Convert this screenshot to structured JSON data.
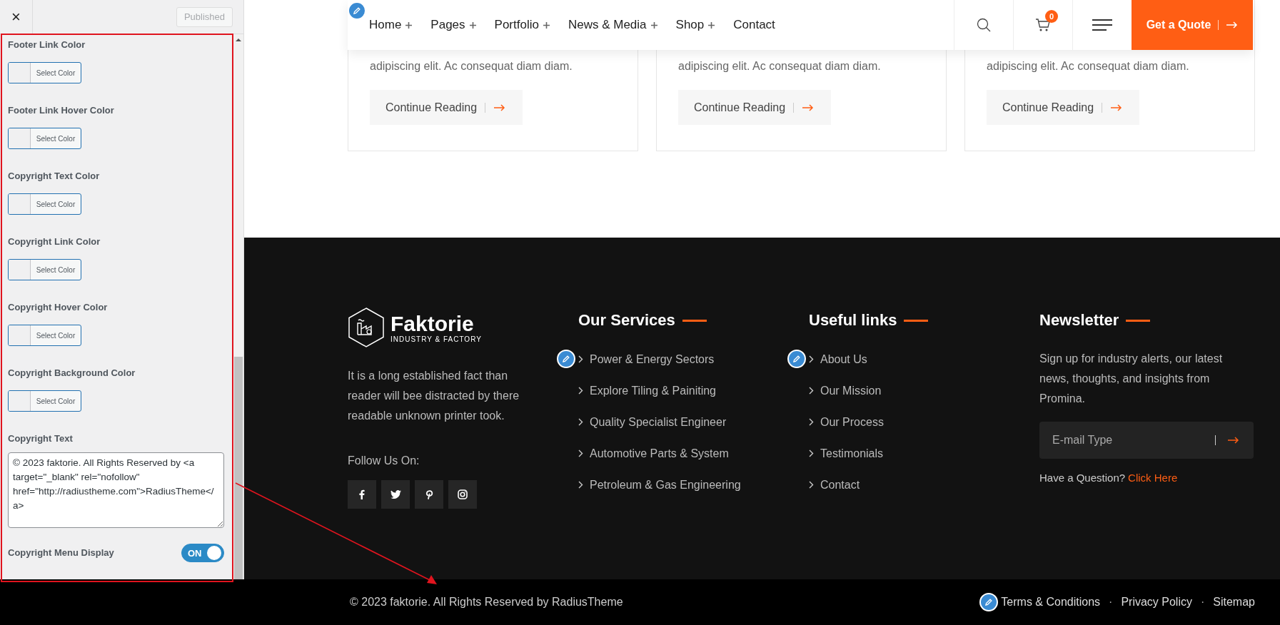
{
  "customizer": {
    "close": "×",
    "publish_button": "Published",
    "color_settings": [
      {
        "label": "Footer Link Color",
        "button": "Select Color"
      },
      {
        "label": "Footer Link Hover Color",
        "button": "Select Color"
      },
      {
        "label": "Copyright Text Color",
        "button": "Select Color"
      },
      {
        "label": "Copyright Link Color",
        "button": "Select Color"
      },
      {
        "label": "Copyright Hover Color",
        "button": "Select Color"
      },
      {
        "label": "Copyright Background Color",
        "button": "Select Color"
      }
    ],
    "copyright_text": {
      "label": "Copyright Text",
      "value": "© 2023 faktorie. All Rights Reserved by <a target=\"_blank\" rel=\"nofollow\" href=\"http://radiustheme.com\">RadiusTheme</a>"
    },
    "copyright_menu": {
      "label": "Copyright Menu Display",
      "toggle_text": "ON",
      "on": true
    }
  },
  "nav": {
    "items": [
      {
        "label": "Home",
        "has_submenu": true
      },
      {
        "label": "Pages",
        "has_submenu": true
      },
      {
        "label": "Portfolio",
        "has_submenu": true
      },
      {
        "label": "News & Media",
        "has_submenu": true
      },
      {
        "label": "Shop",
        "has_submenu": true
      },
      {
        "label": "Contact",
        "has_submenu": false
      }
    ],
    "cart_count": "0",
    "quote_button": "Get a Quote"
  },
  "posts": [
    {
      "excerpt": "adipiscing elit. Ac consequat diam diam.",
      "button": "Continue Reading"
    },
    {
      "excerpt": "adipiscing elit. Ac consequat diam diam.",
      "button": "Continue Reading"
    },
    {
      "excerpt": "adipiscing elit. Ac consequat diam diam.",
      "button": "Continue Reading"
    }
  ],
  "footer": {
    "logo": {
      "name": "Faktorie",
      "tagline": "INDUSTRY & FACTORY"
    },
    "about": "It is a long established fact than reader will bee distracted by there readable unknown printer took.",
    "follow_label": "Follow Us On:",
    "social": [
      {
        "kind": "facebook"
      },
      {
        "kind": "twitter"
      },
      {
        "kind": "pinterest"
      },
      {
        "kind": "instagram"
      }
    ],
    "services": {
      "title": "Our Services",
      "links": [
        "Power & Energy Sectors",
        "Explore Tiling & Painiting",
        "Quality Specialist Engineer",
        "Automotive Parts & System",
        "Petroleum & Gas Engineering"
      ]
    },
    "useful": {
      "title": "Useful links",
      "links": [
        "About Us",
        "Our Mission",
        "Our Process",
        "Testimonials",
        "Contact"
      ]
    },
    "newsletter": {
      "title": "Newsletter",
      "text": "Sign up for industry alerts, our latest news, thoughts, and insights from Promina.",
      "placeholder": "E-mail Type",
      "question": "Have a Question?",
      "link": "Click Here"
    }
  },
  "bottom_bar": {
    "copyright": "© 2023 faktorie. All Rights Reserved by RadiusTheme",
    "links": [
      "Terms & Conditions",
      "Privacy Policy",
      "Sitemap"
    ],
    "separators": [
      "·",
      "·"
    ]
  }
}
